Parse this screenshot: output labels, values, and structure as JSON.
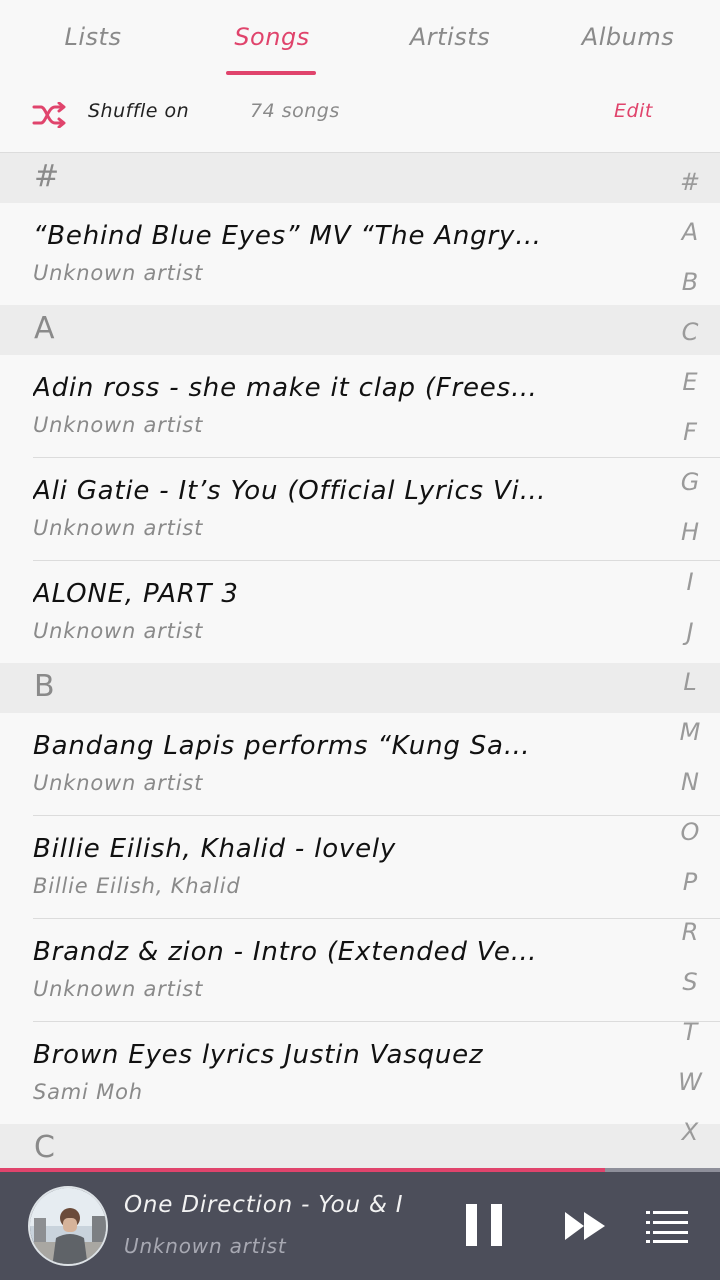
{
  "tabs": [
    {
      "label": "Lists",
      "active": false
    },
    {
      "label": "Songs",
      "active": true
    },
    {
      "label": "Artists",
      "active": false
    },
    {
      "label": "Albums",
      "active": false
    }
  ],
  "toolbar": {
    "shuffle_label": "Shuffle on",
    "song_count": "74 songs",
    "edit_label": "Edit"
  },
  "sections": {
    "hash": "#",
    "a": "A",
    "b": "B",
    "c": "C"
  },
  "songs": [
    {
      "title": "“Behind Blue Eyes” MV “The Angry…",
      "artist": "Unknown artist"
    },
    {
      "title": "Adin ross - she make it clap (Frees…",
      "artist": "Unknown artist"
    },
    {
      "title": "Ali Gatie - It’s You (Official Lyrics Vi…",
      "artist": "Unknown artist"
    },
    {
      "title": "ALONE, PART 3",
      "artist": "Unknown artist"
    },
    {
      "title": "Bandang Lapis performs “Kung Sa…",
      "artist": "Unknown artist"
    },
    {
      "title": "Billie Eilish, Khalid - lovely",
      "artist": "Billie Eilish, Khalid"
    },
    {
      "title": "Brandz & zion - Intro (Extended Ve…",
      "artist": "Unknown artist"
    },
    {
      "title": "Brown Eyes lyrics Justin Vasquez",
      "artist": "Sami Moh"
    }
  ],
  "index_letters": [
    "#",
    "A",
    "B",
    "C",
    "E",
    "F",
    "G",
    "H",
    "I",
    "J",
    "L",
    "M",
    "N",
    "O",
    "P",
    "R",
    "S",
    "T",
    "W",
    "X"
  ],
  "player": {
    "title": "One Direction - You & I",
    "artist": "Unknown artist",
    "progress": 0.84
  },
  "colors": {
    "accent": "#e0446c",
    "player_bg": "#4c4e5a",
    "section_bg": "#ececec"
  },
  "icons": {
    "shuffle": "shuffle-icon",
    "pause": "pause-icon",
    "next": "next-icon",
    "queue": "queue-icon"
  }
}
